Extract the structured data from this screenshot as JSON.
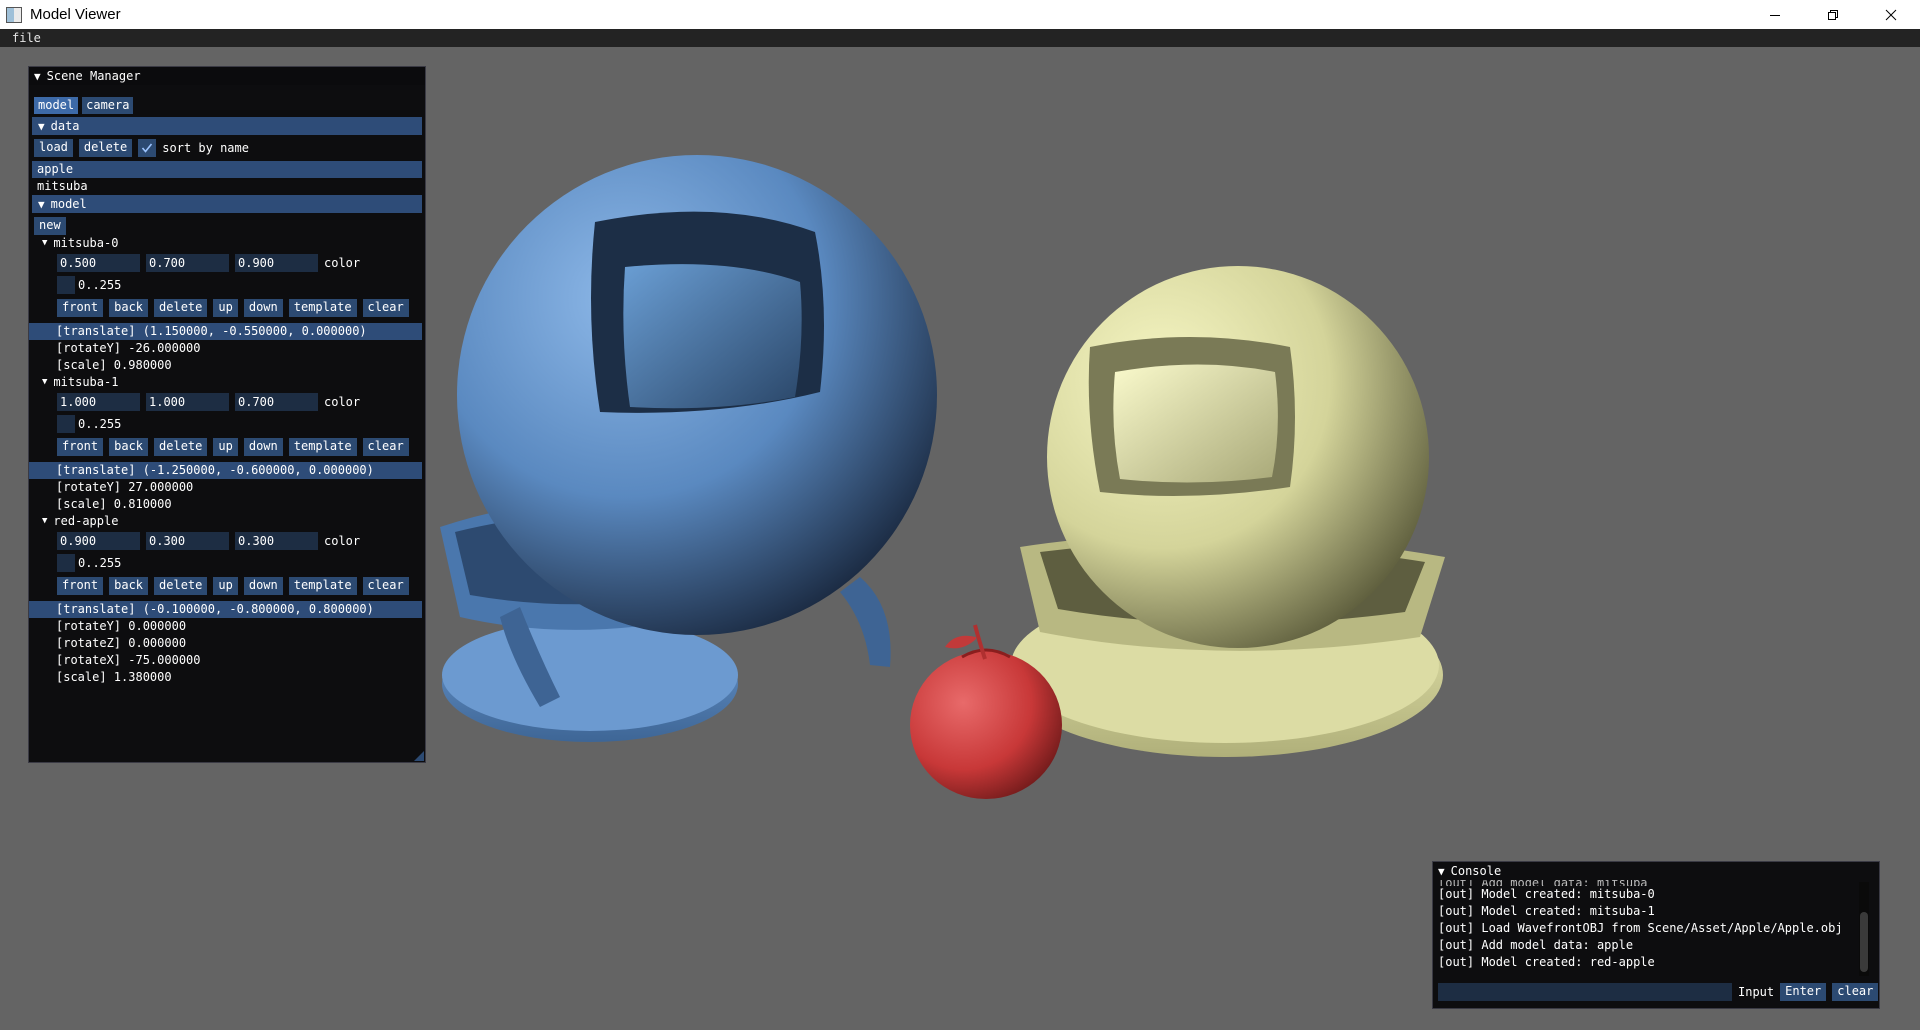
{
  "window": {
    "title": "Model Viewer"
  },
  "menu": {
    "file": "file"
  },
  "scene_manager": {
    "title": "Scene Manager",
    "tabs": [
      "model",
      "camera"
    ],
    "data_header": "data",
    "load_label": "load",
    "delete_label": "delete",
    "sort_label": "sort by name",
    "sort_checked": true,
    "data_items": [
      "apple",
      "mitsuba"
    ],
    "model_header": "model",
    "new_label": "new",
    "button_labels": [
      "front",
      "back",
      "delete",
      "up",
      "down",
      "template",
      "clear"
    ],
    "color_label": "color",
    "range_label": "0..255",
    "models": [
      {
        "name": "mitsuba-0",
        "values": [
          "0.500",
          "0.700",
          "0.900"
        ],
        "color_hex": "#6a99cc",
        "props": [
          "[translate] (1.150000, -0.550000, 0.000000)",
          "[rotateY] -26.000000",
          "[scale] 0.980000"
        ]
      },
      {
        "name": "mitsuba-1",
        "values": [
          "1.000",
          "1.000",
          "0.700"
        ],
        "color_hex": "#e8e8b2",
        "props": [
          "[translate] (-1.250000, -0.600000, 0.000000)",
          "[rotateY] 27.000000",
          "[scale] 0.810000"
        ]
      },
      {
        "name": "red-apple",
        "values": [
          "0.900",
          "0.300",
          "0.300"
        ],
        "color_hex": "#e64d4d",
        "props": [
          "[translate] (-0.100000, -0.800000, 0.800000)",
          "[rotateY] 0.000000",
          "[rotateZ] 0.000000",
          "[rotateX] -75.000000",
          "[scale] 1.380000"
        ]
      }
    ]
  },
  "console": {
    "title": "Console",
    "partial_line": "[out] Add model data: mitsuba",
    "lines": [
      "[out] Model created: mitsuba-0",
      "[out] Model created: mitsuba-1",
      "[out] Load WavefrontOBJ from Scene/Asset/Apple/Apple.obj",
      "[out] Add model data: apple",
      "[out] Model created: red-apple"
    ],
    "input_label": "Input",
    "enter_label": "Enter",
    "clear_label": "clear"
  },
  "colors": {
    "background": "#646464",
    "panel": "#0d0d0f",
    "button": "#2c4a72",
    "header": "#2e4c78",
    "blue_model": "#5f8fc7",
    "yellow_model": "#e2e2a8",
    "apple": "#d23c3c"
  }
}
